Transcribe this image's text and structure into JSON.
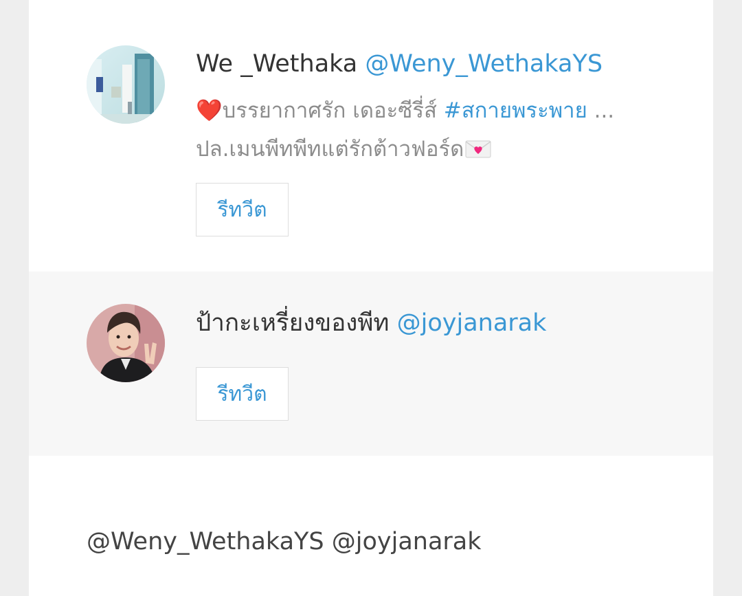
{
  "tweets": [
    {
      "avatar_icon": "user-avatar-photo-icon",
      "display_name": "We _Wethaka",
      "handle": "@Weny_WethakaYS",
      "text": {
        "emoji_heart": "❤️",
        "line1_text": "บรรยากาศรัก เดอะซีรี่ส์ ",
        "line1_hashtag": "#สกายพระพาย",
        "line1_ellipsis": " ...",
        "line2_text": "ปล.เมนพีทพีทแต่รักต้าวฟอร์ด",
        "emoji_envelope": "💌"
      },
      "retweet_label": "รีทวีต"
    },
    {
      "avatar_icon": "user-avatar-photo-icon",
      "display_name": "ป้ากะเหรี่ยงของพีท",
      "handle": "@joyjanarak",
      "retweet_label": "รีทวีต"
    }
  ],
  "reply_mentions": "@Weny_WethakaYS @joyjanarak",
  "colors": {
    "link": "#3a97d4",
    "text": "#333333",
    "muted": "#8c8c8c",
    "background": "#eeeeee"
  }
}
